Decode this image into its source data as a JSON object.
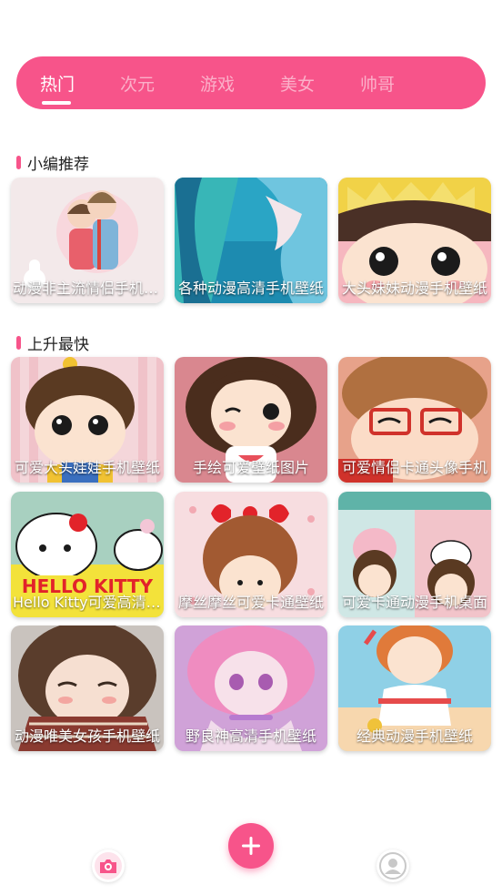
{
  "tabs": [
    {
      "label": "热门",
      "active": true
    },
    {
      "label": "次元",
      "active": false
    },
    {
      "label": "游戏",
      "active": false
    },
    {
      "label": "美女",
      "active": false
    },
    {
      "label": "帅哥",
      "active": false
    }
  ],
  "sections": [
    {
      "title": "小编推荐",
      "items": [
        {
          "caption": "动漫非主流情侣手机壁纸"
        },
        {
          "caption": "各种动漫高清手机壁纸"
        },
        {
          "caption": "大头妹妹动漫手机壁纸"
        }
      ]
    },
    {
      "title": "上升最快",
      "items": [
        {
          "caption": "可爱大头娃娃手机壁纸"
        },
        {
          "caption": "手绘可爱壁纸图片"
        },
        {
          "caption": "可爱情侣卡通头像手机"
        },
        {
          "caption": "Hello Kitty可爱高清壁纸"
        },
        {
          "caption": "摩丝摩丝可爱卡通壁纸"
        },
        {
          "caption": "可爱卡通动漫手机桌面"
        },
        {
          "caption": "动漫唯美女孩手机壁纸"
        },
        {
          "caption": "野良神高清手机壁纸"
        },
        {
          "caption": "经典动漫手机壁纸"
        }
      ]
    }
  ],
  "bottom_nav": {
    "left_icon": "camera-icon",
    "center_icon": "plus-icon",
    "right_icon": "user-icon"
  },
  "colors": {
    "accent": "#f7548a",
    "tab_inactive": "#fbb0c9",
    "text": "#222222"
  }
}
